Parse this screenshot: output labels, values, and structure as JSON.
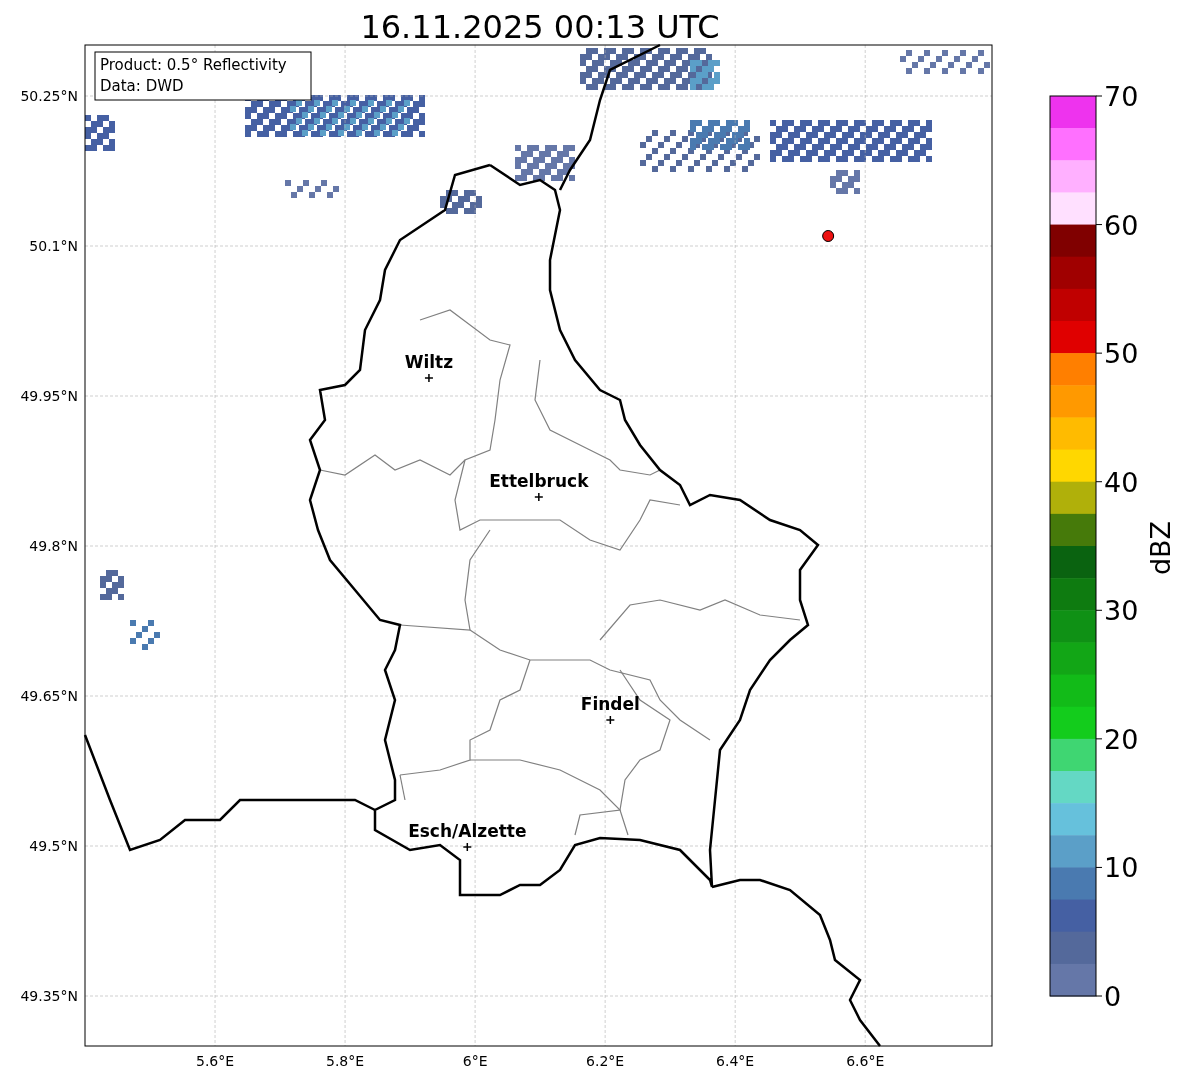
{
  "title": "16.11.2025 00:13 UTC",
  "info_box": [
    "Product: 0.5° Reflectivity",
    "Data: DWD"
  ],
  "map": {
    "chart_data": {
      "type": "scatter",
      "grid": true,
      "xlim": [
        5.4,
        6.795
      ],
      "ylim": [
        49.3,
        50.301
      ],
      "xticks": [
        {
          "value": 5.6,
          "label": "5.6°E"
        },
        {
          "value": 5.8,
          "label": "5.8°E"
        },
        {
          "value": 6.0,
          "label": "6°E"
        },
        {
          "value": 6.2,
          "label": "6.2°E"
        },
        {
          "value": 6.4,
          "label": "6.4°E"
        },
        {
          "value": 6.6,
          "label": "6.6°E"
        }
      ],
      "yticks": [
        {
          "value": 50.25,
          "label": "50.25°N"
        },
        {
          "value": 50.1,
          "label": "50.1°N"
        },
        {
          "value": 49.95,
          "label": "49.95°N"
        },
        {
          "value": 49.8,
          "label": "49.8°N"
        },
        {
          "value": 49.65,
          "label": "49.65°N"
        },
        {
          "value": 49.5,
          "label": "49.5°N"
        },
        {
          "value": 49.35,
          "label": "49.35°N"
        }
      ],
      "series": [
        {
          "color": "#000000",
          "x": [
            5.929,
            6.098,
            6.208,
            5.988
          ],
          "values": [
            49.968,
            49.849,
            49.626,
            49.499
          ]
        },
        {
          "color": "#ee1111",
          "x": [
            6.543
          ],
          "values": [
            50.11
          ]
        }
      ],
      "annotations": [
        {
          "x": 5.929,
          "y": 49.968,
          "text": "Wiltz"
        },
        {
          "x": 6.098,
          "y": 49.849,
          "text": "Ettelbruck"
        },
        {
          "x": 6.208,
          "y": 49.626,
          "text": "Findel"
        },
        {
          "x": 5.988,
          "y": 49.499,
          "text": "Esch/Alzette"
        }
      ]
    }
  },
  "colorbar": {
    "label": "dBZ",
    "ticks": [
      "70",
      "60",
      "50",
      "40",
      "30",
      "20",
      "10",
      "0"
    ],
    "bands": [
      {
        "color": "#ee33ee"
      },
      {
        "color": "#ff70ff"
      },
      {
        "color": "#ffb0ff"
      },
      {
        "color": "#ffe0ff"
      },
      {
        "color": "#800000"
      },
      {
        "color": "#a00000"
      },
      {
        "color": "#c00000"
      },
      {
        "color": "#e00000"
      },
      {
        "color": "#ff7f00"
      },
      {
        "color": "#ff9900"
      },
      {
        "color": "#ffbb00"
      },
      {
        "color": "#ffd700"
      },
      {
        "color": "#b0b00a"
      },
      {
        "color": "#467a0a"
      },
      {
        "color": "#0a6310"
      },
      {
        "color": "#0e7b10"
      },
      {
        "color": "#0f9115"
      },
      {
        "color": "#12a616"
      },
      {
        "color": "#12bb18"
      },
      {
        "color": "#13cc1c"
      },
      {
        "color": "#3fd672"
      },
      {
        "color": "#64d8c4"
      },
      {
        "color": "#66c1dc"
      },
      {
        "color": "#5b9fc8"
      },
      {
        "color": "#4a7ab0"
      },
      {
        "color": "#4560a3"
      },
      {
        "color": "#54699b"
      },
      {
        "color": "#6577a8"
      }
    ]
  }
}
